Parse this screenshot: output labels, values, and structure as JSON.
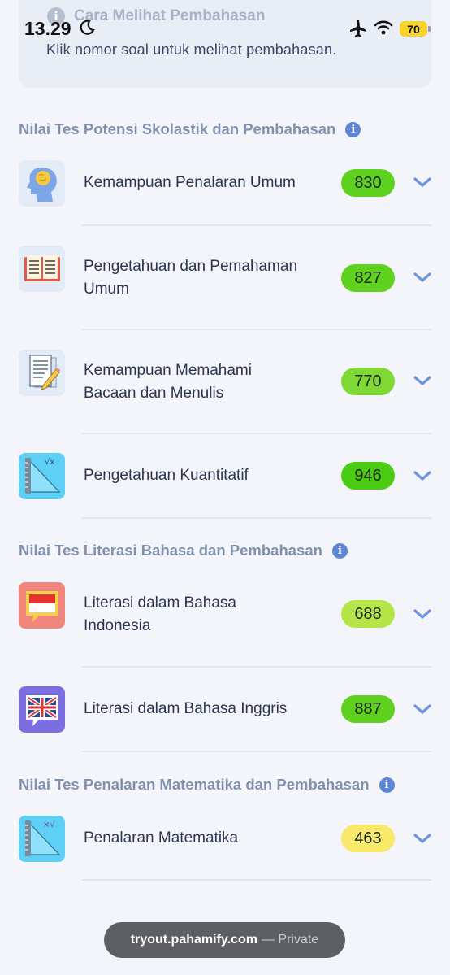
{
  "status": {
    "time": "13.29",
    "battery": "70"
  },
  "info": {
    "title": "Cara Melihat Pembahasan",
    "desc": "Klik nomor soal untuk melihat pembahasan."
  },
  "sections": [
    {
      "title": "Nilai Tes Potensi Skolastik dan Pembahasan"
    },
    {
      "title": "Nilai Tes Literasi Bahasa dan Pembahasan"
    },
    {
      "title": "Nilai Tes Penalaran Matematika dan Pembahasan"
    }
  ],
  "rows": [
    {
      "line1": "Kemampuan Penalaran Umum",
      "line2": "",
      "score": "830",
      "score_color": "#5fd11f",
      "icon": "head-brain-icon"
    },
    {
      "line1": "Pengetahuan dan Pemahaman",
      "line2": "Umum",
      "score": "827",
      "score_color": "#5fd11f",
      "icon": "open-book-icon"
    },
    {
      "line1": "Kemampuan Memahami",
      "line2": "Bacaan dan Menulis",
      "score": "770",
      "score_color": "#7fd833",
      "icon": "document-pencil-icon"
    },
    {
      "line1": "Pengetahuan Kuantitatif",
      "line2": "",
      "score": "946",
      "score_color": "#4ccb15",
      "icon": "ruler-geometry-icon"
    },
    {
      "line1": "Literasi dalam Bahasa",
      "line2": "Indonesia",
      "score": "688",
      "score_color": "#b6e548",
      "icon": "indonesia-flag-chat-icon"
    },
    {
      "line1": "Literasi dalam Bahasa Inggris",
      "line2": "",
      "score": "887",
      "score_color": "#5fd11f",
      "icon": "uk-flag-chat-icon"
    },
    {
      "line1": "Penalaran Matematika",
      "line2": "",
      "score": "463",
      "score_color": "#f8e96a",
      "icon": "ruler-geometry-icon"
    }
  ],
  "browser": {
    "url": "tryout.pahamify.com",
    "suffix": "— Private"
  }
}
